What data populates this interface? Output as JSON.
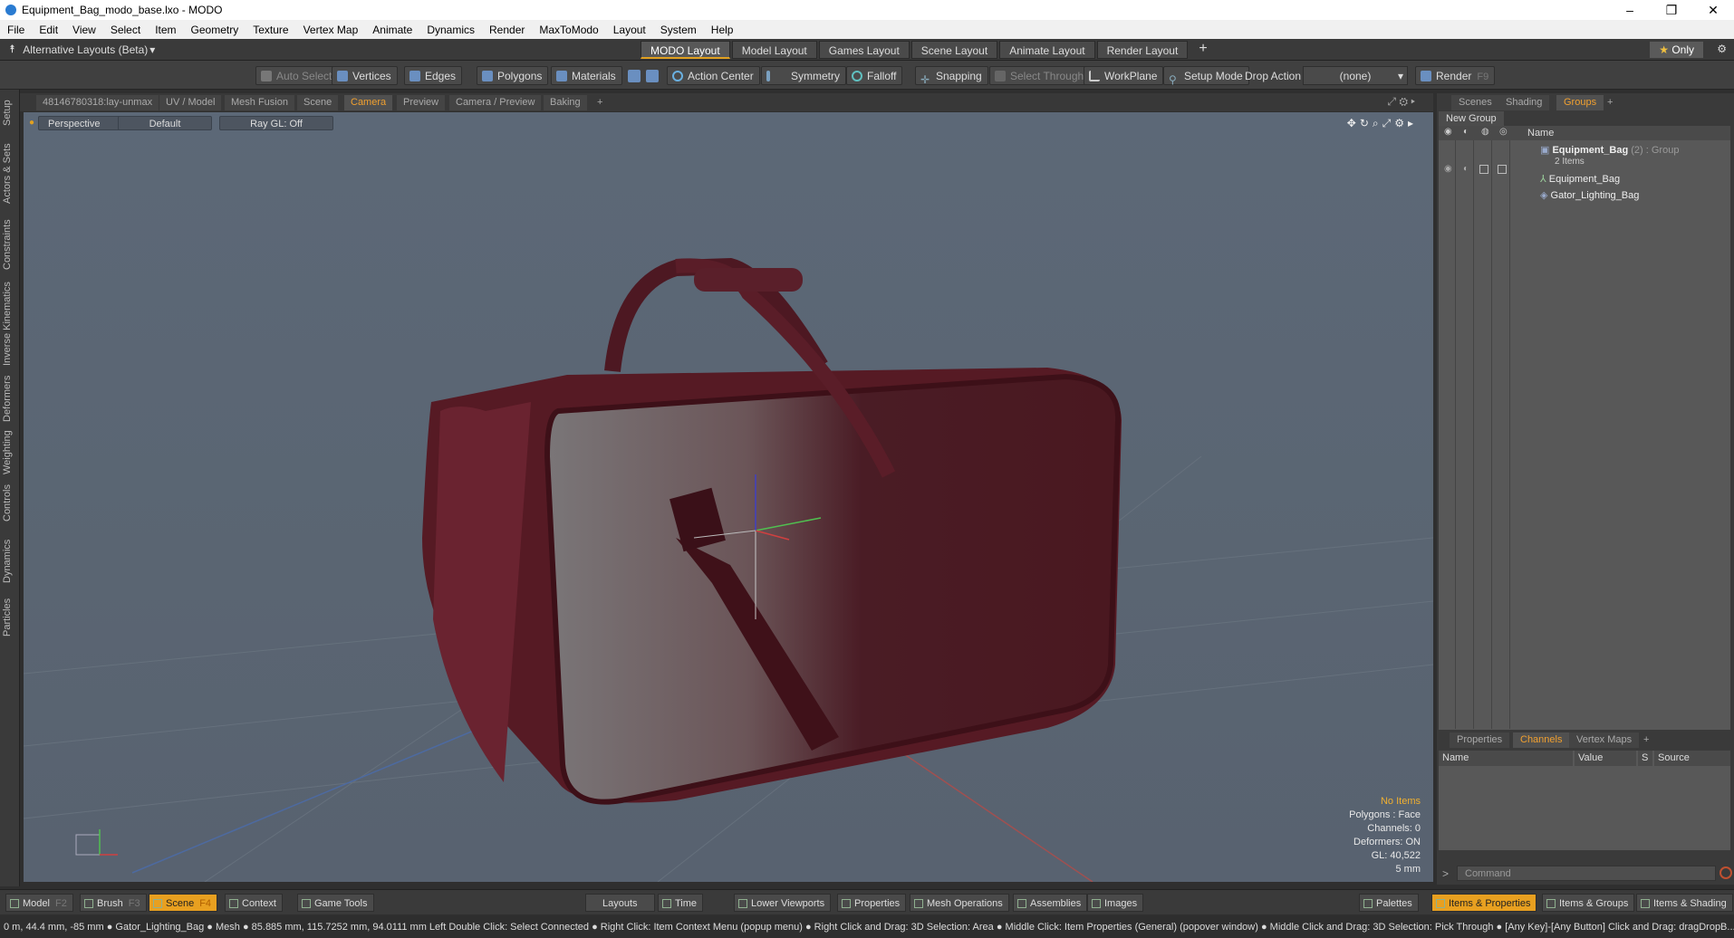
{
  "window": {
    "title": "Equipment_Bag_modo_base.lxo - MODO",
    "min": "–",
    "max": "❐",
    "close": "✕"
  },
  "menu": [
    "File",
    "Edit",
    "View",
    "Select",
    "Item",
    "Geometry",
    "Texture",
    "Vertex Map",
    "Animate",
    "Dynamics",
    "Render",
    "MaxToModo",
    "Layout",
    "System",
    "Help"
  ],
  "layoutbar": {
    "alt_layouts": "Alternative Layouts (Beta)",
    "tabs": [
      "MODO Layout",
      "Model Layout",
      "Games Layout",
      "Scene Layout",
      "Animate Layout",
      "Render Layout"
    ],
    "add": "+",
    "only": "Only"
  },
  "toolbar": {
    "auto_select": "Auto Select",
    "vertices": "Vertices",
    "edges": "Edges",
    "polygons": "Polygons",
    "materials": "Materials",
    "action_center": "Action Center",
    "symmetry": "Symmetry",
    "falloff": "Falloff",
    "snapping": "Snapping",
    "select_through": "Select Through",
    "workplane": "WorkPlane",
    "setup_mode": "Setup Mode",
    "drop_action": "Drop Action",
    "drop_value": "(none)",
    "render": "Render",
    "render_key": "F9"
  },
  "left_tabs": [
    "Setup",
    "Actors & Sets",
    "Constraints",
    "Inverse Kinematics",
    "Deformers",
    "Weighting",
    "Controls",
    "Dynamics",
    "Particles"
  ],
  "viewport_tabs": [
    "48146780318:lay-unmax",
    "UV / Model",
    "Mesh Fusion",
    "Scene",
    "Camera",
    "Preview",
    "Camera / Preview",
    "Baking",
    "+"
  ],
  "viewport": {
    "perspective": "Perspective",
    "default": "Default",
    "raygl": "Ray GL: Off",
    "hud": {
      "no_items": "No Items",
      "polygons": "Polygons : Face",
      "channels": "Channels: 0",
      "deformers": "Deformers: ON",
      "gl": "GL: 40,522",
      "scale": "5 mm"
    }
  },
  "right_panel": {
    "tabs": [
      "Scenes",
      "Shading",
      "Groups",
      "+"
    ],
    "new_group": "New Group",
    "name_header": "Name",
    "group_name": "Equipment_Bag",
    "group_suffix": "(2) : Group",
    "group_count": "2 Items",
    "items": [
      "Equipment_Bag",
      "Gator_Lighting_Bag"
    ],
    "lower_tabs": [
      "Properties",
      "Channels",
      "Vertex Maps",
      "+"
    ],
    "ch_headers": [
      "Name",
      "Value",
      "S",
      "Source"
    ],
    "command_placeholder": "Command"
  },
  "bottombar": {
    "model": "Model",
    "model_key": "F2",
    "brush": "Brush",
    "brush_key": "F3",
    "scene": "Scene",
    "scene_key": "F4",
    "context": "Context",
    "game_tools": "Game Tools",
    "layouts": "Layouts",
    "time": "Time",
    "lower_viewports": "Lower Viewports",
    "properties": "Properties",
    "mesh_operations": "Mesh Operations",
    "assemblies": "Assemblies",
    "images": "Images",
    "palettes": "Palettes",
    "items_properties": "Items & Properties",
    "items_groups": "Items & Groups",
    "items_shading": "Items & Shading"
  },
  "status": "0 m, 44.4 mm, -85 mm ● Gator_Lighting_Bag ● Mesh ● 85.885 mm, 115.7252 mm, 94.0111 mm     Left Double Click: Select Connected ● Right Click: Item Context Menu (popup menu) ● Right Click and Drag: 3D Selection: Area ● Middle Click: Item Properties (General) (popover window) ● Middle Click and Drag: 3D Selection: Pick Through ● [Any Key]-[Any Button] Click and Drag: dragDropB..."
}
